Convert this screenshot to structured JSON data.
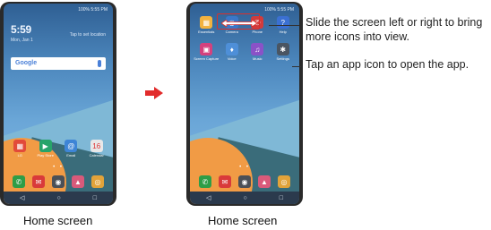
{
  "left_phone": {
    "status_right": "100% 5:55 PM",
    "clock": "5:59",
    "clock_sub": "Mon, Jan 1",
    "clock_right": "Tap to set location",
    "search_label": "Google",
    "apps": [
      {
        "label": "LG",
        "color": "#e24a3a",
        "glyph": "▦"
      },
      {
        "label": "Play Store",
        "color": "#27a46a",
        "glyph": "▶"
      },
      {
        "label": "Email",
        "color": "#3e85d6",
        "glyph": "@"
      },
      {
        "label": "Calendar",
        "color": "#e8e8e8",
        "glyph": "16"
      }
    ],
    "dock": [
      {
        "color": "#2e9d47",
        "glyph": "✆"
      },
      {
        "color": "#d93a3a",
        "glyph": "✉"
      },
      {
        "color": "#4b5057",
        "glyph": "◉"
      },
      {
        "color": "#d95a7a",
        "glyph": "▲"
      },
      {
        "color": "#e2a33a",
        "glyph": "◎"
      }
    ],
    "nav": [
      "◁",
      "○",
      "□"
    ]
  },
  "right_phone": {
    "status_right": "100% 5:55 PM",
    "apps_row1": [
      {
        "label": "Essentials",
        "color": "#f2b23f",
        "glyph": "▦"
      },
      {
        "label": "Camera",
        "color": "#3a77c8",
        "glyph": "◉"
      },
      {
        "label": "Phone",
        "color": "#d23b3b",
        "glyph": "✆"
      },
      {
        "label": "Help",
        "color": "#3b70d2",
        "glyph": "?"
      }
    ],
    "apps_row2": [
      {
        "label": "Screen Capture",
        "color": "#d4417e",
        "glyph": "▣"
      },
      {
        "label": "Voice",
        "color": "#4e8fd8",
        "glyph": "♦"
      },
      {
        "label": "Music",
        "color": "#8a52c7",
        "glyph": "♫"
      },
      {
        "label": "Settings",
        "color": "#4a5562",
        "glyph": "✱"
      }
    ],
    "dock": [
      {
        "color": "#2e9d47",
        "glyph": "✆"
      },
      {
        "color": "#d93a3a",
        "glyph": "✉"
      },
      {
        "color": "#4b5057",
        "glyph": "◉"
      },
      {
        "color": "#d95a7a",
        "glyph": "▲"
      },
      {
        "color": "#e2a33a",
        "glyph": "◎"
      }
    ],
    "nav": [
      "◁",
      "○",
      "□"
    ]
  },
  "captions": {
    "left": "Home screen",
    "right": "Home screen"
  },
  "callouts": {
    "swipe": "Slide the screen left or right to bring more icons into view.",
    "tap": "Tap an app icon to open the app."
  },
  "colors": {
    "arrow": "#e22b2b",
    "highlight": "#d9302c"
  }
}
